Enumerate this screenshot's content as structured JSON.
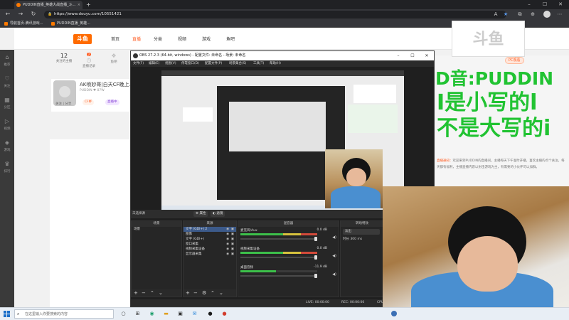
{
  "browser": {
    "tab_title": "PUDDIN直播_英雄大战直播_斗...",
    "tab_close": "×",
    "new_tab": "+",
    "win_min": "–",
    "win_max": "☐",
    "win_close": "✕",
    "url": "https://www.douyu.com/10551421",
    "bookmarks": [
      "导航首页-腾讯游戏...",
      "PUDDIN直播_英雄..."
    ]
  },
  "site": {
    "logo": "斗鱼",
    "nav": [
      "首页",
      "直播",
      "分类",
      "视频",
      "游戏",
      "鱼吧"
    ],
    "rail": [
      "推荐",
      "关注",
      "分区",
      "视频",
      "游戏",
      "排行"
    ],
    "stats": [
      {
        "num": "12",
        "label": "关注的主播",
        "badge": ""
      },
      {
        "num": "",
        "label": "直播记录",
        "badge": "2"
      },
      {
        "num": "",
        "label": "鱼吧",
        "badge": ""
      }
    ],
    "room_title": "AK喷妙哥|白天CF晚上...",
    "room_meta": "PUDDIN  ♥  87W",
    "room_tag1": "CF杯",
    "room_tag2": "直播中",
    "room_follow": "关注 | 分享"
  },
  "stream_overlay": {
    "logo": "斗鱼",
    "line1": "D音:PUDDIN",
    "line2": "I是小写的l",
    "line3": "不是大写的i",
    "pc_button": "PC观看",
    "notice_title": "直播通知",
    "notice_body": "欢迎来到PUDDIN的直播间，主播每天下午准时开播，喜欢主播的点个关注，每天都有福利，主播直播内容以射击游戏为主，有需要的小伙伴可以加群。"
  },
  "obs": {
    "title": "OBS 27.2.3 (64-bit, windows) - 配置文件: 未命名 - 场景: 未命名",
    "menu": [
      "文件(F)",
      "编辑(E)",
      "视图(V)",
      "停靠窗口(D)",
      "配置文件(P)",
      "场景集合(S)",
      "工具(T)",
      "帮助(H)"
    ],
    "no_source": "未选择源",
    "props_btn": "属性",
    "filter_btn": "滤镜",
    "docks": {
      "scenes": "场景",
      "sources": "来源",
      "mixer": "混音器",
      "transitions": "转场特效"
    },
    "scene_items": [
      "场景"
    ],
    "source_items": [
      "文字 (GDI+) 2",
      "图像",
      "文字 (GDI+)",
      "窗口采集",
      "视频采集设备",
      "显示器采集"
    ],
    "mixer_items": [
      {
        "name": "麦克风/Aux",
        "value": "0.0 dB"
      },
      {
        "name": "视频采集设备",
        "value": "0.0 dB"
      },
      {
        "name": "桌面音频",
        "value": "-11.9 dB"
      }
    ],
    "transition": "淡出",
    "duration_label": "时长",
    "duration_value": "300 ms",
    "status": [
      "LIVE: 00:00:00",
      "REC: 00:00:00",
      "CPU: 3.8%, 30.00 fps"
    ]
  },
  "taskbar": {
    "search_placeholder": "在这里输入你要搜索的内容"
  }
}
